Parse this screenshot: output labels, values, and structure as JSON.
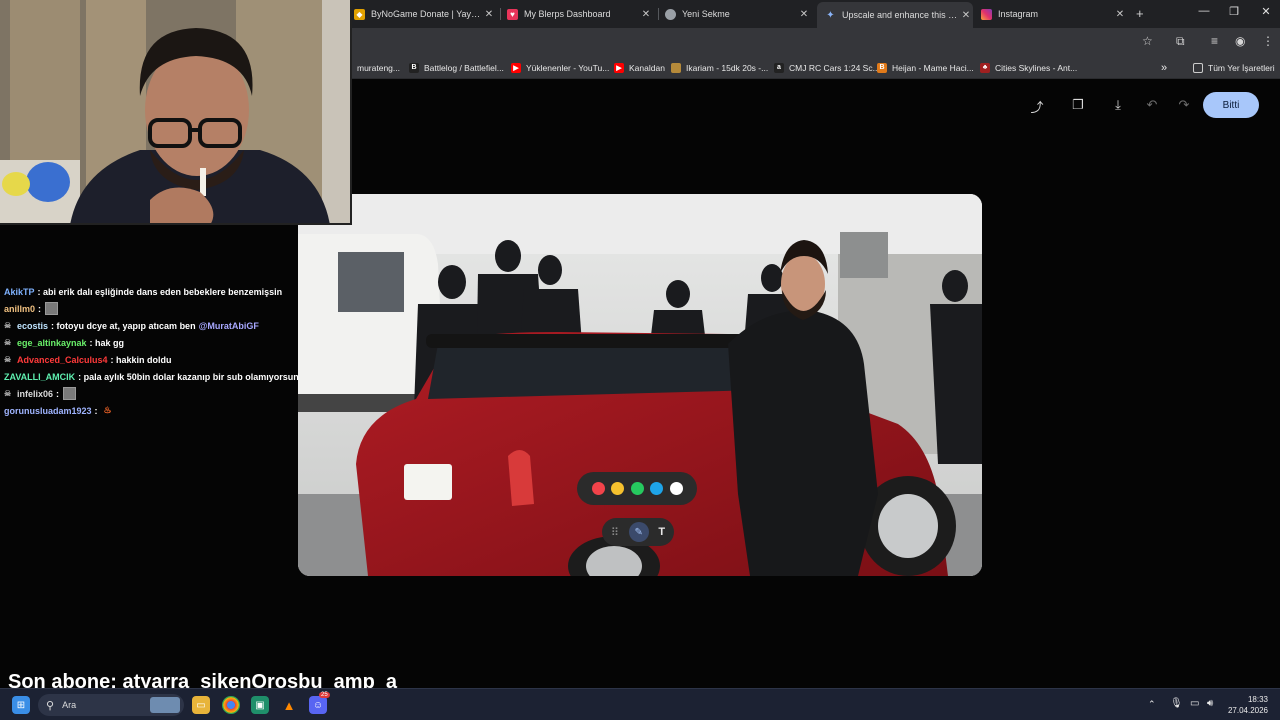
{
  "tabs": [
    {
      "title": "ByNoGame Donate | Yayıncıya",
      "icon": "bynogame-icon",
      "color": "#e0a000"
    },
    {
      "title": "My Blerps Dashboard",
      "icon": "blerp-icon",
      "color": "#e8345a"
    },
    {
      "title": "Yeni Sekme",
      "icon": "chrome-icon",
      "color": "#9aa0a6"
    },
    {
      "title": "Upscale and enhance this imag",
      "icon": "gemini-icon",
      "color": "#8ab4f8",
      "active": true
    },
    {
      "title": "Instagram",
      "icon": "instagram-icon",
      "color": "#e1306c"
    }
  ],
  "bookmarks": [
    {
      "label": "murateng...",
      "icon": "doc-icon",
      "color": "#555"
    },
    {
      "label": "Battlelog / Battlefiel...",
      "icon": "battlelog-icon",
      "color": "#222",
      "glyph": "B"
    },
    {
      "label": "Yüklenenler - YouTu...",
      "icon": "youtube-icon",
      "color": "#ff0000"
    },
    {
      "label": "Kanaldan",
      "icon": "youtube-icon",
      "color": "#ff0000"
    },
    {
      "label": "Ikariam - 15dk 20s -...",
      "icon": "ikariam-icon",
      "color": "#b58a3a"
    },
    {
      "label": "CMJ RC Cars 1:24 Sc...",
      "icon": "amazon-icon",
      "color": "#222",
      "glyph": "a"
    },
    {
      "label": "Heijan - Mame Haci...",
      "icon": "heijan-icon",
      "color": "#e07a1a",
      "glyph": "B"
    },
    {
      "label": "Cities Skylines - Ant...",
      "icon": "skylines-icon",
      "color": "#a02020"
    },
    {
      "label": "Tüm Yer İşaretleri",
      "icon": "folder-icon",
      "color": "#35363a"
    }
  ],
  "editor": {
    "finish_label": "Bitti",
    "palette_colors": [
      "#f2434a",
      "#f6c12e",
      "#26c95f",
      "#1ea4e8",
      "#ffffff"
    ],
    "text_tool": "T"
  },
  "chat": [
    {
      "user": "AkikTP",
      "color": "#7fb2ff",
      "text": ": abi erik dalı eşliğinde dans eden bebeklere benzemişsin",
      "badge": false
    },
    {
      "user": "anillm0",
      "color": "#f0c080",
      "text": ":",
      "badge": false,
      "emote": true
    },
    {
      "user": "ecostis",
      "color": "#bfe4ff",
      "text": ": fotoyu dcye at, yapıp atıcam ben",
      "mention": "@MuratAbiGF",
      "badge": true
    },
    {
      "user": "ege_altinkaynak",
      "color": "#6af06a",
      "text": ": hak gg",
      "badge": true
    },
    {
      "user": "Advanced_Calculus4",
      "color": "#ff3a3a",
      "text": ": hakkin doldu",
      "badge": true
    },
    {
      "user": "ZAVALLI_AMCIK",
      "color": "#5ff0b0",
      "text": ": pala aylık 50bin dolar kazanıp bir sub olamıyorsun",
      "badge": false
    },
    {
      "user": "infelix06",
      "color": "#dcdcdc",
      "text": ":",
      "badge": true,
      "emote": true
    },
    {
      "user": "gorunusluadam1923",
      "color": "#9fb4ff",
      "text": ":",
      "badge": false,
      "flame": true
    }
  ],
  "sub_banner": "Son abone: atyarra_sikenOrosbu_amp_a",
  "taskbar": {
    "search_placeholder": "Ara",
    "time": "18:33",
    "date": "27.04.2026",
    "discord_badge": "25"
  }
}
